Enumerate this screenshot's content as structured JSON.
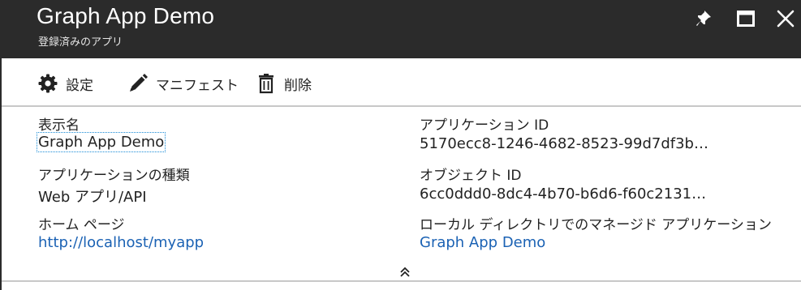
{
  "header": {
    "title": "Graph App Demo",
    "subtitle": "登録済みのアプリ",
    "controls": [
      "pin-icon",
      "maximize-icon",
      "close-icon"
    ]
  },
  "toolbar": {
    "settings_label": "設定",
    "manifest_label": "マニフェスト",
    "delete_label": "削除"
  },
  "essentials": {
    "display_name": {
      "label": "表示名",
      "value": "Graph App Demo"
    },
    "application_id": {
      "label": "アプリケーション ID",
      "value": "5170ecc8-1246-4682-8523-99d7df3b…"
    },
    "application_type": {
      "label": "アプリケーションの種類",
      "value": "Web アプリ/API"
    },
    "object_id": {
      "label": "オブジェクト ID",
      "value": "6cc0ddd0-8dc4-4b70-b6d6-f60c2131…"
    },
    "home_page": {
      "label": "ホーム ページ",
      "value": "http://localhost/myapp"
    },
    "managed_app": {
      "label": "ローカル ディレクトリでのマネージド アプリケーション",
      "value": "Graph App Demo"
    }
  },
  "colors": {
    "header_bg": "#2b2b2b",
    "link": "#1b62b4",
    "divider": "#c8c8c8"
  }
}
